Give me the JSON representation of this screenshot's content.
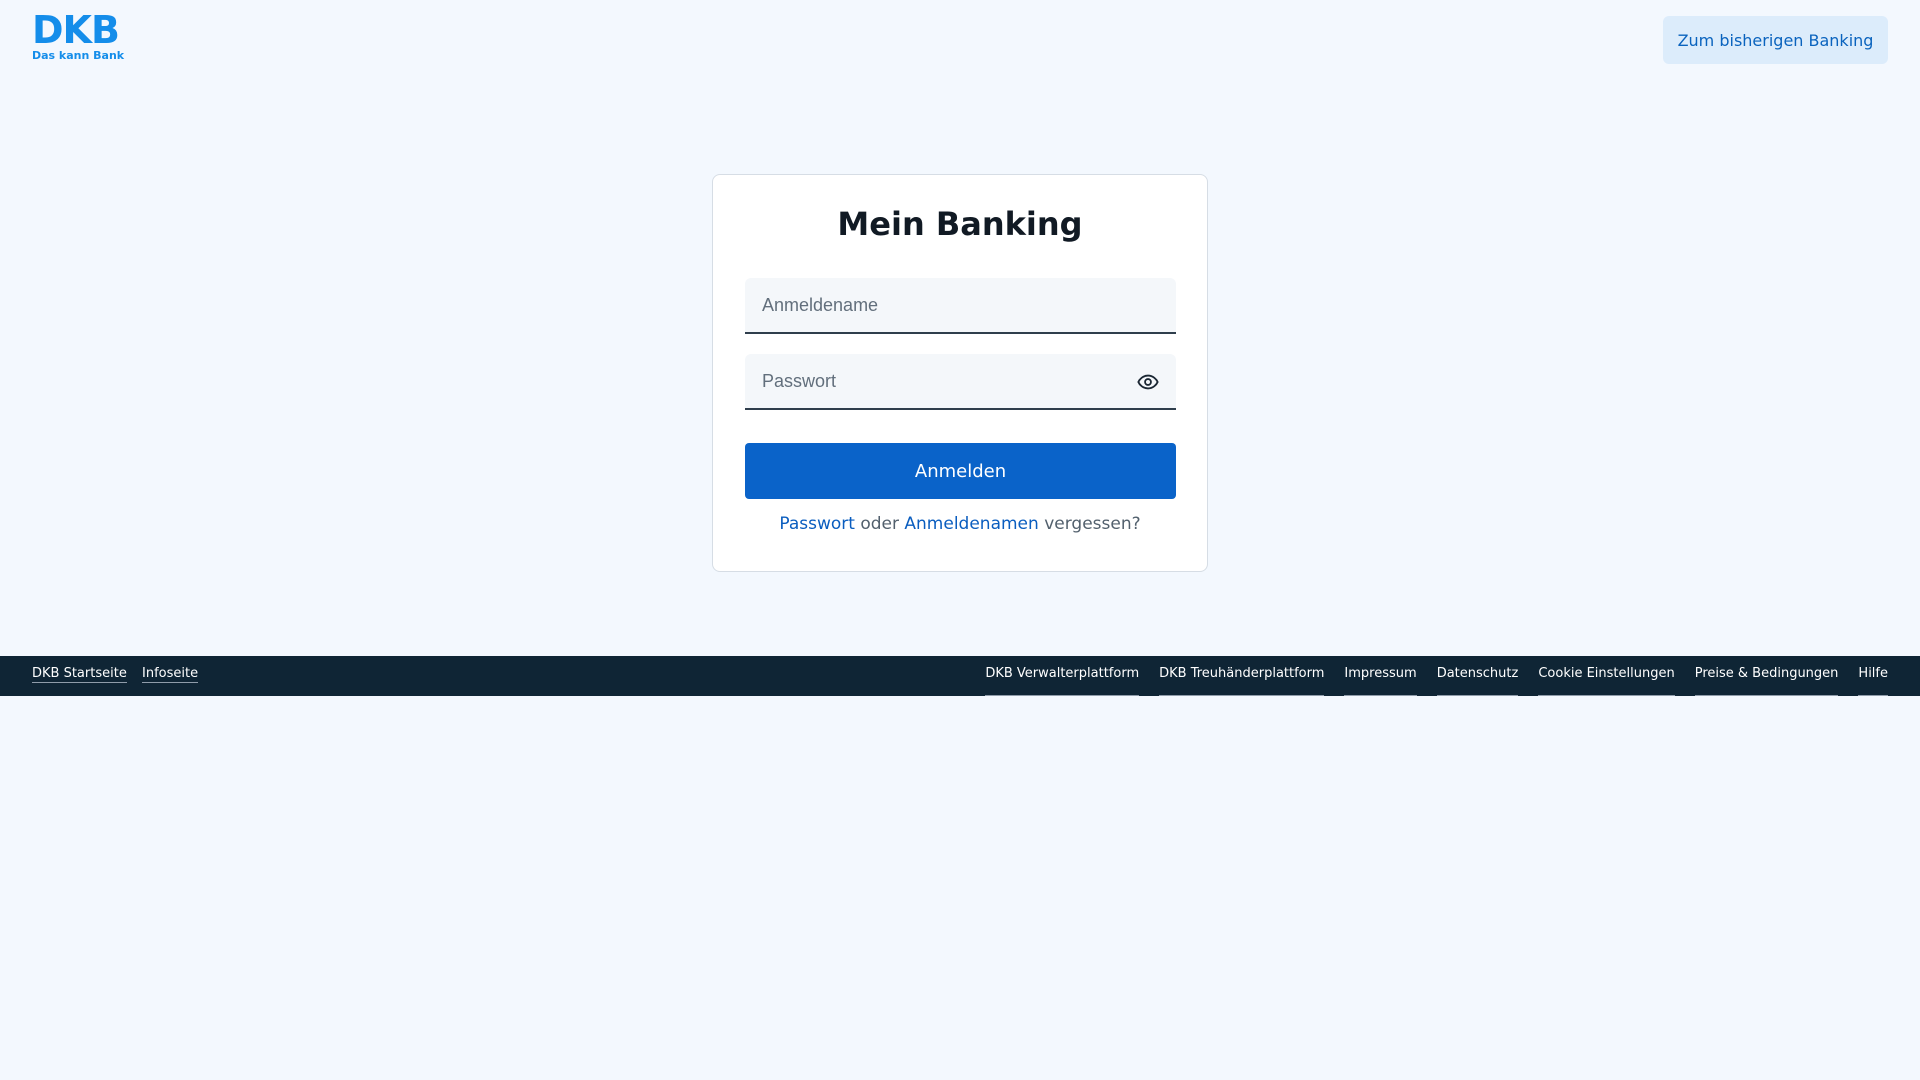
{
  "header": {
    "logo_main": "DKB",
    "logo_sub": "Das kann Bank",
    "legacy_button": "Zum bisherigen Banking"
  },
  "login": {
    "title": "Mein Banking",
    "username_placeholder": "Anmeldename",
    "username_value": "",
    "password_placeholder": "Passwort",
    "password_value": "",
    "submit_label": "Anmelden",
    "forgot_password_link": "Passwort",
    "forgot_or": " oder ",
    "forgot_username_link": "Anmeldenamen",
    "forgot_suffix": " vergessen?"
  },
  "footer": {
    "left": [
      "DKB Startseite",
      "Infoseite"
    ],
    "right": [
      "DKB Verwalterplattform",
      "DKB Treuhänderplattform",
      "Impressum",
      "Datenschutz",
      "Cookie Einstellungen",
      "Preise & Bedingungen",
      "Hilfe"
    ]
  },
  "icons": {
    "password_toggle": "eye-icon"
  },
  "colors": {
    "brand": "#148dea",
    "primary_button": "#0a63c9",
    "footer_bg": "#0f2535",
    "page_bg": "#f3f8fe"
  }
}
